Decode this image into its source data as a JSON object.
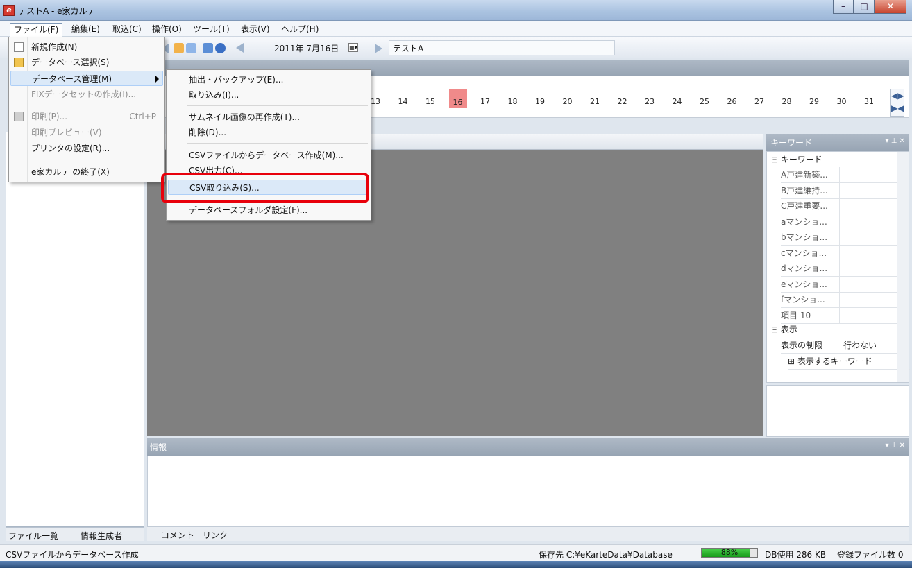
{
  "window": {
    "title": "テストA - e家カルテ"
  },
  "menubar": [
    "ファイル(F)",
    "編集(E)",
    "取込(C)",
    "操作(O)",
    "ツール(T)",
    "表示(V)",
    "ヘルプ(H)"
  ],
  "toolbar": {
    "date": "2011年  7月16日",
    "datepick": "▦▾",
    "name": "テストA"
  },
  "calendar": {
    "days": [
      "13",
      "14",
      "15",
      "16",
      "17",
      "18",
      "19",
      "20",
      "21",
      "22",
      "23",
      "24",
      "25",
      "26",
      "27",
      "28",
      "29",
      "30",
      "31"
    ],
    "selected": "16",
    "selected_color": "#f08a8a"
  },
  "file_menu": {
    "items": [
      {
        "label": "新規作成(N)",
        "shortcut": "",
        "icon": "new-document-icon"
      },
      {
        "label": "データベース選択(S)",
        "shortcut": "",
        "icon": "folder-open-icon"
      },
      {
        "label": "データベース管理(M)",
        "shortcut": "",
        "icon": ""
      },
      {
        "label": "FIXデータセットの作成(I)...",
        "shortcut": "",
        "icon": ""
      },
      {
        "label": "印刷(P)...",
        "shortcut": "Ctrl+P",
        "icon": "printer-icon"
      },
      {
        "label": "印刷プレビュー(V)",
        "shortcut": "",
        "icon": ""
      },
      {
        "label": "プリンタの設定(R)...",
        "shortcut": "",
        "icon": ""
      },
      {
        "label": "e家カルテ の終了(X)",
        "shortcut": "",
        "icon": ""
      }
    ]
  },
  "submenu": {
    "items": [
      "抽出・バックアップ(E)...",
      "取り込み(I)...",
      "サムネイル画像の再作成(T)...",
      "削除(D)...",
      "CSVファイルからデータベース作成(M)...",
      "CSV出力(C)...",
      "CSV取り込み(S)...",
      "データベースフォルダ設定(F)..."
    ],
    "highlighted": "CSV取り込み(S)...",
    "highlight_color": "#e8000b"
  },
  "keyword_panel": {
    "title": "キーワード",
    "category1": "⊟ キーワード",
    "keywords": [
      "A戸建新築...",
      "B戸建維持...",
      "C戸建重要...",
      "aマンショ...",
      "bマンショ...",
      "cマンショ...",
      "dマンショ...",
      "eマンショ...",
      "fマンショ...",
      "項目 10"
    ],
    "category2": "⊟ 表示",
    "limit_label": "表示の制限",
    "limit_value": "行わない",
    "show_keywords": "⊞ 表示するキーワード"
  },
  "info_panel": {
    "title": "情報"
  },
  "left_tabs": [
    "ファイル一覧",
    "情報生成者"
  ],
  "info_tabs": [
    "コメント",
    "リンク"
  ],
  "status": {
    "message": "CSVファイルからデータベース作成",
    "save_path": "保存先 C:¥eKarteData¥Database",
    "progress_text": "88%",
    "progress": 0.88,
    "db_usage": "DB使用 286 KB",
    "file_count": "登録ファイル数 0"
  }
}
